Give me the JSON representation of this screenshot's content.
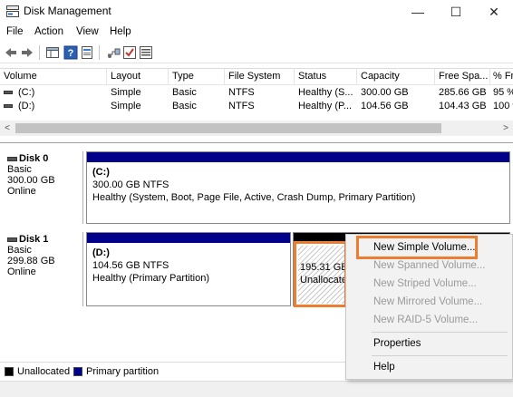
{
  "window": {
    "title": "Disk Management",
    "minimize_glyph": "—",
    "maximize_glyph": "☐",
    "close_glyph": "✕"
  },
  "menu": [
    "File",
    "Action",
    "View",
    "Help"
  ],
  "toolbar_icons": [
    "back-arrow-icon",
    "forward-arrow-icon",
    "show-hide-tree-icon",
    "help-icon",
    "properties-icon",
    "connect-icon",
    "refresh-icon",
    "list-icon"
  ],
  "volume_list": {
    "columns": [
      "Volume",
      "Layout",
      "Type",
      "File System",
      "Status",
      "Capacity",
      "Free Spa...",
      "% Fr"
    ],
    "rows": [
      {
        "volume": "(C:)",
        "layout": "Simple",
        "type": "Basic",
        "fs": "NTFS",
        "status": "Healthy (S...",
        "capacity": "300.00 GB",
        "free": "285.66 GB",
        "pct": "95 %"
      },
      {
        "volume": "(D:)",
        "layout": "Simple",
        "type": "Basic",
        "fs": "NTFS",
        "status": "Healthy (P...",
        "capacity": "104.56 GB",
        "free": "104.43 GB",
        "pct": "100 %"
      }
    ]
  },
  "scroll": {
    "left_arrow": "<",
    "right_arrow": ">"
  },
  "disks": [
    {
      "name": "Disk 0",
      "type": "Basic",
      "size": "300.00 GB",
      "state": "Online",
      "partitions": [
        {
          "name": "(C:)",
          "size": "300.00 GB NTFS",
          "status": "Healthy (System, Boot, Page File, Active, Crash Dump, Primary Partition)"
        }
      ]
    },
    {
      "name": "Disk 1",
      "type": "Basic",
      "size": "299.88 GB",
      "state": "Online",
      "partitions": [
        {
          "name": "(D:)",
          "size": "104.56 GB NTFS",
          "status": "Healthy (Primary Partition)"
        },
        {
          "name": "",
          "size": "195.31 GB",
          "status": "Unallocate"
        }
      ]
    }
  ],
  "legend": [
    {
      "label": "Unallocated",
      "color": "#000000"
    },
    {
      "label": "Primary partition",
      "color": "#00008b"
    }
  ],
  "context_menu": {
    "items": [
      {
        "label": "New Simple Volume...",
        "enabled": true
      },
      {
        "label": "New Spanned Volume...",
        "enabled": false
      },
      {
        "label": "New Striped Volume...",
        "enabled": false
      },
      {
        "label": "New Mirrored Volume...",
        "enabled": false
      },
      {
        "label": "New RAID-5 Volume...",
        "enabled": false
      },
      {
        "label": "Properties",
        "enabled": true
      },
      {
        "label": "Help",
        "enabled": true
      }
    ]
  },
  "colors": {
    "primary_partition": "#00008b",
    "unallocated": "#000000",
    "highlight": "#ed7d31"
  }
}
